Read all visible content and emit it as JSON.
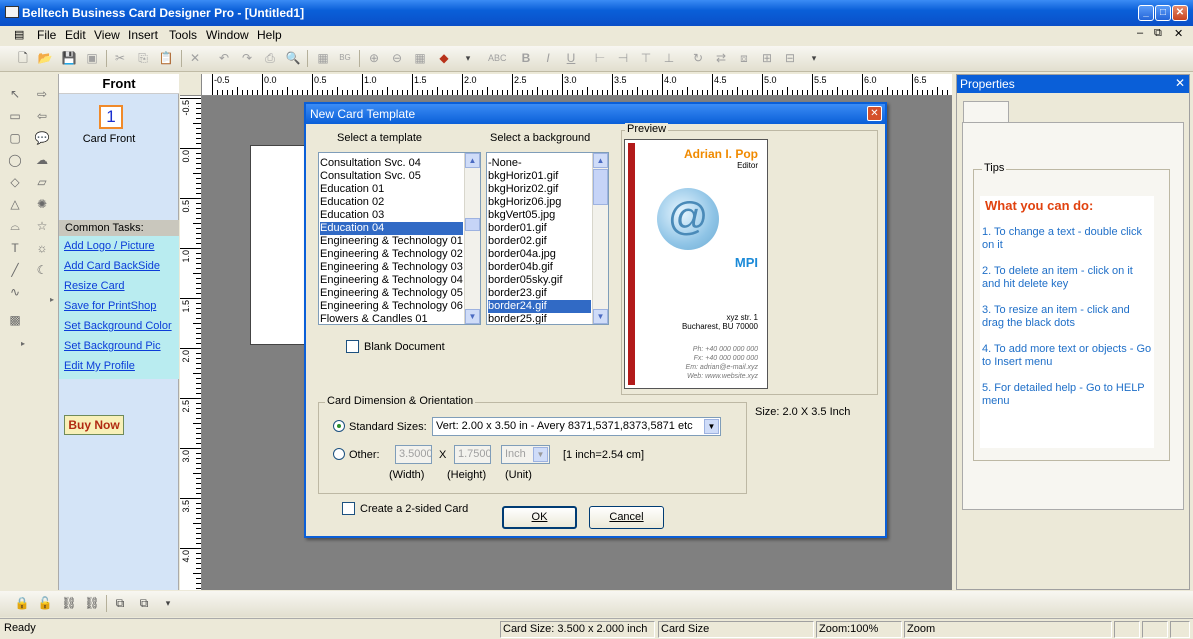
{
  "window": {
    "title": "Belltech Business Card Designer Pro  - [Untitled1]"
  },
  "menu": [
    "File",
    "Edit",
    "View",
    "Insert",
    "Tools",
    "Window",
    "Help"
  ],
  "task_pane": {
    "header": "Front",
    "card_number": "1",
    "card_label": "Card Front",
    "tasks_header": "Common Tasks:",
    "tasks": [
      "Add Logo / Picture",
      "Add Card BackSide",
      "Resize Card",
      "Save for PrintShop",
      "Set Background Color",
      "Set Background Pic",
      "Edit My Profile"
    ],
    "buy_now": "Buy Now"
  },
  "ruler": {
    "h_labels": [
      "-0.5",
      "0.0",
      "0.5",
      "1.0",
      "1.5",
      "2.0",
      "2.5",
      "3.0",
      "3.5",
      "4.0",
      "4.5",
      "5.0",
      "5.5",
      "6.0",
      "6.5"
    ],
    "v_labels": [
      "-0.5",
      "0.0",
      "0.5",
      "1.0",
      "1.5",
      "2.0",
      "2.5",
      "3.0",
      "3.5",
      "4.0"
    ]
  },
  "properties": {
    "title": "Properties",
    "tips_label": "Tips",
    "tips_title": "What you can do:",
    "tips": [
      "1. To change a text - double click on it",
      "2. To delete an item - click on it and hit delete key",
      "3. To resize an item - click and drag the black dots",
      "4. To add more text or objects - Go to Insert menu",
      "5. For detailed help - Go to HELP menu"
    ]
  },
  "dialog": {
    "title": "New Card Template",
    "template_label": "Select a template",
    "background_label": "Select a background",
    "preview_label": "Preview",
    "templates": [
      "Consultation Svc. 04",
      "Consultation Svc. 05",
      "Education 01",
      "Education 02",
      "Education 03",
      "Education 04",
      "Engineering & Technology 01",
      "Engineering & Technology 02",
      "Engineering & Technology 03",
      "Engineering & Technology 04",
      "Engineering & Technology 05",
      "Engineering & Technology 06",
      "Flowers & Candles 01"
    ],
    "selected_template": "Education 04",
    "backgrounds": [
      "-None-",
      "bkgHoriz01.gif",
      "bkgHoriz02.gif",
      "bkgHoriz06.jpg",
      "bkgVert05.jpg",
      "border01.gif",
      "border02.gif",
      "border04a.jpg",
      "border04b.gif",
      "border05sky.gif",
      "border23.gif",
      "border24.gif",
      "border25.gif"
    ],
    "selected_background": "border24.gif",
    "blank_document": "Blank Document",
    "preview_card": {
      "name": "Adrian I. Pop",
      "title": "Editor",
      "company": "MPI",
      "address1": "xyz str. 1",
      "address2": "Bucharest, BU 70000",
      "phone": "Ph: +40 000 000 000",
      "fax": "Fx: +40 000 000 000",
      "email": "Em: adrian@e-mail.xyz",
      "web": "Web: www.website.xyz"
    },
    "size_text": "Size: 2.0 X 3.5 Inch",
    "dimension_group": "Card Dimension & Orientation",
    "standard_sizes_label": "Standard Sizes:",
    "standard_size_value": "Vert:  2.00 x 3.50 in - Avery 8371,5371,8373,5871 etc",
    "other_label": "Other:",
    "other_width": "3.5000",
    "other_height": "1.7500",
    "x_label": "X",
    "unit_value": "Inch",
    "inch_note": "[1 inch=2.54 cm]",
    "width_label": "(Width)",
    "height_label": "(Height)",
    "unit_label": "(Unit)",
    "two_sided": "Create a 2-sided Card",
    "ok": "OK",
    "cancel": "Cancel"
  },
  "status": {
    "ready": "Ready",
    "card_size": "Card Size: 3.500 x 2.000 inch",
    "card_size_label": "Card Size",
    "zoom": "Zoom:100%",
    "zoom_label": "Zoom"
  }
}
